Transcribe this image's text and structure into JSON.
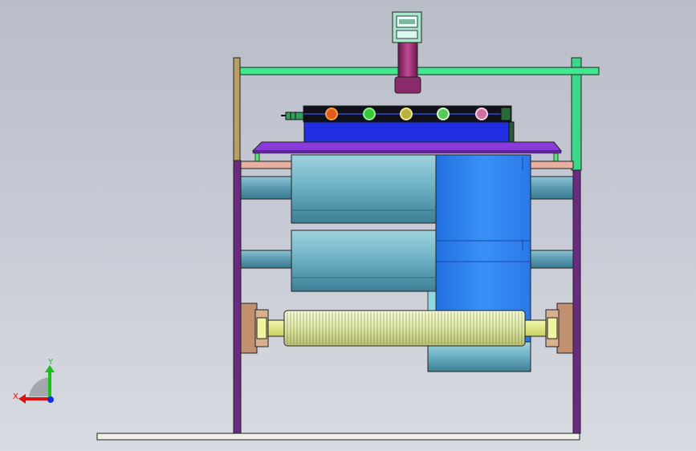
{
  "view": {
    "background_top": "#b9bdc8",
    "background_bottom": "#d9dbe2"
  },
  "triad": {
    "x_label": "X",
    "y_label": "Y",
    "x_color": "#e01010",
    "y_color": "#18c018",
    "z_color": "#1030e0"
  },
  "colors": {
    "frame_post": "#6a2a80",
    "left_post_upper": "#b8a060",
    "green_rail": "#40e890",
    "base_plate": "#f0f0e8",
    "roller_body": "#7bbccc",
    "roller_shaft": "#5a9ab0",
    "blue_housing": "#2f86f0",
    "blue_bar": "#1e2ee0",
    "tray": "#8a3ad8",
    "crossbar": "#e8b0a0",
    "camera_column": "#a83a7a",
    "knurled_roller": "#e8f0b8",
    "bearing_block": "#c09070",
    "bearing_shaft": "#e8f090"
  }
}
